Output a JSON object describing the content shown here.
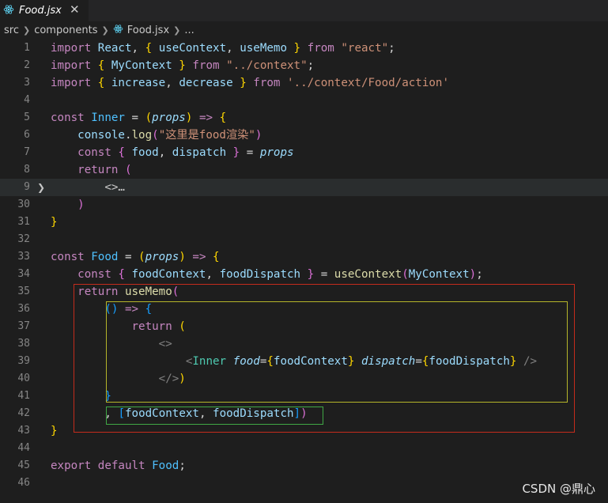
{
  "tab": {
    "title": "Food.jsx",
    "close_label": "✕",
    "icon": "react-icon"
  },
  "breadcrumb": {
    "items": [
      "src",
      "components",
      "Food.jsx",
      "..."
    ]
  },
  "folded_placeholder": "<>…",
  "lines": [
    {
      "n": "1",
      "tokens": [
        [
          "import ",
          "kw"
        ],
        [
          "React",
          "var"
        ],
        [
          ", ",
          "p"
        ],
        [
          "{ ",
          "b1"
        ],
        [
          "useContext",
          "var"
        ],
        [
          ", ",
          "p"
        ],
        [
          "useMemo",
          "var"
        ],
        [
          " }",
          "b1"
        ],
        [
          " from ",
          "kw"
        ],
        [
          "\"react\"",
          "str"
        ],
        [
          ";",
          "p"
        ]
      ]
    },
    {
      "n": "2",
      "tokens": [
        [
          "import ",
          "kw"
        ],
        [
          "{ ",
          "b1"
        ],
        [
          "MyContext",
          "var"
        ],
        [
          " }",
          "b1"
        ],
        [
          " from ",
          "kw"
        ],
        [
          "\"../context\"",
          "str"
        ],
        [
          ";",
          "p"
        ]
      ]
    },
    {
      "n": "3",
      "tokens": [
        [
          "import ",
          "kw"
        ],
        [
          "{ ",
          "b1"
        ],
        [
          "increase",
          "var"
        ],
        [
          ", ",
          "p"
        ],
        [
          "decrease",
          "var"
        ],
        [
          " }",
          "b1"
        ],
        [
          " from ",
          "kw"
        ],
        [
          "'../context/Food/action'",
          "str"
        ]
      ]
    },
    {
      "n": "4",
      "tokens": []
    },
    {
      "n": "5",
      "tokens": [
        [
          "const ",
          "kw"
        ],
        [
          "Inner",
          "const"
        ],
        [
          " = ",
          "p"
        ],
        [
          "(",
          "b1"
        ],
        [
          "props",
          "param"
        ],
        [
          ")",
          "b1"
        ],
        [
          " => ",
          "kw"
        ],
        [
          "{",
          "b1"
        ]
      ]
    },
    {
      "n": "6",
      "tokens": [
        [
          "    ",
          "p"
        ],
        [
          "console",
          "var"
        ],
        [
          ".",
          "p"
        ],
        [
          "log",
          "fn"
        ],
        [
          "(",
          "b2"
        ],
        [
          "\"这里是food渲染\"",
          "str"
        ],
        [
          ")",
          "b2"
        ]
      ]
    },
    {
      "n": "7",
      "tokens": [
        [
          "    ",
          "p"
        ],
        [
          "const ",
          "kw"
        ],
        [
          "{ ",
          "b2"
        ],
        [
          "food",
          "var"
        ],
        [
          ", ",
          "p"
        ],
        [
          "dispatch",
          "var"
        ],
        [
          " }",
          "b2"
        ],
        [
          " = ",
          "p"
        ],
        [
          "props",
          "param"
        ]
      ]
    },
    {
      "n": "8",
      "tokens": [
        [
          "    ",
          "p"
        ],
        [
          "return ",
          "kw"
        ],
        [
          "(",
          "b2"
        ]
      ]
    },
    {
      "n": "9",
      "fold": true,
      "tokens": [
        [
          "        ",
          "p"
        ],
        [
          "<>…",
          "fold"
        ]
      ]
    },
    {
      "n": "30",
      "tokens": [
        [
          "    ",
          "p"
        ],
        [
          ")",
          "b2"
        ]
      ]
    },
    {
      "n": "31",
      "tokens": [
        [
          "}",
          "b1"
        ]
      ]
    },
    {
      "n": "32",
      "tokens": []
    },
    {
      "n": "33",
      "tokens": [
        [
          "const ",
          "kw"
        ],
        [
          "Food",
          "const"
        ],
        [
          " = ",
          "p"
        ],
        [
          "(",
          "b1"
        ],
        [
          "props",
          "param"
        ],
        [
          ")",
          "b1"
        ],
        [
          " => ",
          "kw"
        ],
        [
          "{",
          "b1"
        ]
      ]
    },
    {
      "n": "34",
      "tokens": [
        [
          "    ",
          "p"
        ],
        [
          "const ",
          "kw"
        ],
        [
          "{ ",
          "b2"
        ],
        [
          "foodContext",
          "var"
        ],
        [
          ", ",
          "p"
        ],
        [
          "foodDispatch",
          "var"
        ],
        [
          " }",
          "b2"
        ],
        [
          " = ",
          "p"
        ],
        [
          "useContext",
          "fn"
        ],
        [
          "(",
          "b2"
        ],
        [
          "MyContext",
          "var"
        ],
        [
          ")",
          "b2"
        ],
        [
          ";",
          "p"
        ]
      ]
    },
    {
      "n": "35",
      "tokens": [
        [
          "    ",
          "p"
        ],
        [
          "return ",
          "kw"
        ],
        [
          "useMemo",
          "fn"
        ],
        [
          "(",
          "b2"
        ]
      ]
    },
    {
      "n": "36",
      "tokens": [
        [
          "        ",
          "p"
        ],
        [
          "()",
          "b3"
        ],
        [
          " => ",
          "kw"
        ],
        [
          "{",
          "b3"
        ]
      ]
    },
    {
      "n": "37",
      "tokens": [
        [
          "            ",
          "p"
        ],
        [
          "return ",
          "kw"
        ],
        [
          "(",
          "b1"
        ]
      ]
    },
    {
      "n": "38",
      "tokens": [
        [
          "                ",
          "p"
        ],
        [
          "<>",
          "tag"
        ]
      ]
    },
    {
      "n": "39",
      "tokens": [
        [
          "                    ",
          "p"
        ],
        [
          "<",
          "tag"
        ],
        [
          "Inner",
          "comp"
        ],
        [
          " ",
          "p"
        ],
        [
          "food",
          "attr"
        ],
        [
          "=",
          "p"
        ],
        [
          "{",
          "b1"
        ],
        [
          "foodContext",
          "var"
        ],
        [
          "}",
          "b1"
        ],
        [
          " ",
          "p"
        ],
        [
          "dispatch",
          "attr"
        ],
        [
          "=",
          "p"
        ],
        [
          "{",
          "b1"
        ],
        [
          "foodDispatch",
          "var"
        ],
        [
          "}",
          "b1"
        ],
        [
          " />",
          "tag"
        ]
      ]
    },
    {
      "n": "40",
      "tokens": [
        [
          "                ",
          "p"
        ],
        [
          "</>",
          "tag"
        ],
        [
          ")",
          "b1"
        ]
      ]
    },
    {
      "n": "41",
      "tokens": [
        [
          "        ",
          "p"
        ],
        [
          "}",
          "b3"
        ]
      ]
    },
    {
      "n": "42",
      "tokens": [
        [
          "        ",
          "p"
        ],
        [
          ", ",
          "p"
        ],
        [
          "[",
          "b3"
        ],
        [
          "foodContext",
          "var"
        ],
        [
          ", ",
          "p"
        ],
        [
          "foodDispatch",
          "var"
        ],
        [
          "]",
          "b3"
        ],
        [
          ")",
          "b2"
        ]
      ]
    },
    {
      "n": "43",
      "tokens": [
        [
          "}",
          "b1"
        ]
      ]
    },
    {
      "n": "44",
      "tokens": []
    },
    {
      "n": "45",
      "tokens": [
        [
          "export ",
          "kw"
        ],
        [
          "default ",
          "kw"
        ],
        [
          "Food",
          "const"
        ],
        [
          ";",
          "p"
        ]
      ]
    },
    {
      "n": "46",
      "tokens": []
    }
  ],
  "annotations": {
    "outer_color": "#c42b1c",
    "callback_color": "#b5b52a",
    "deps_color": "#40a845"
  },
  "watermark": "CSDN @鼎心"
}
